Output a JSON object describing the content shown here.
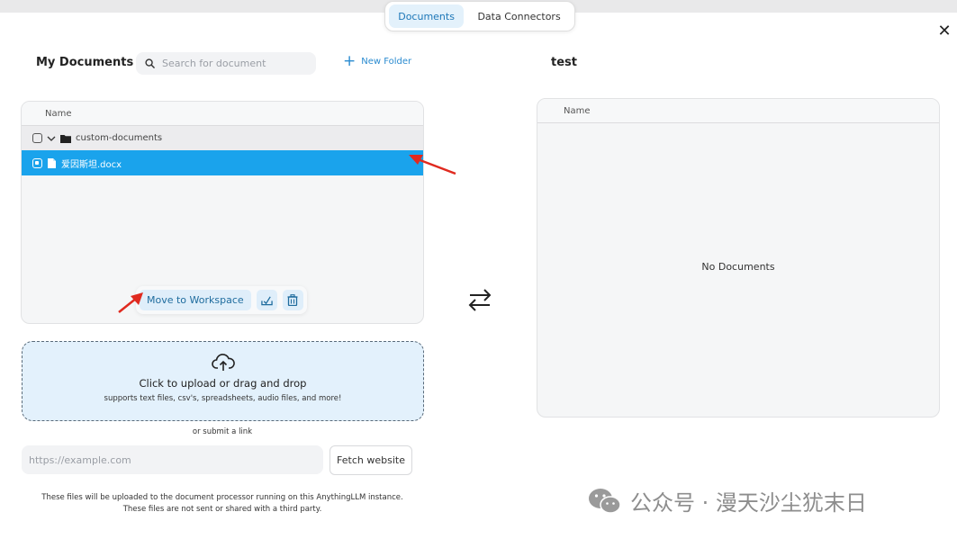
{
  "tabs": [
    {
      "label": "Documents",
      "active": true
    },
    {
      "label": "Data Connectors",
      "active": false
    }
  ],
  "left": {
    "title": "My Documents",
    "search_placeholder": "Search for document",
    "new_folder_label": "New Folder",
    "column_name": "Name",
    "folder_name": "custom-documents",
    "file_name": "爱因斯坦.docx",
    "move_button_label": "Move to Workspace"
  },
  "right": {
    "title": "test",
    "column_name": "Name",
    "empty_text": "No Documents"
  },
  "upload": {
    "title": "Click to upload or drag and drop",
    "subtitle": "supports text files, csv's, spreadsheets, audio files, and more!",
    "or_link": "or submit a link",
    "url_placeholder": "https://example.com",
    "fetch_label": "Fetch website",
    "notice_line1": "These files will be uploaded to the document processor running on this AnythingLLM instance.",
    "notice_line2": "These files are not sent or shared with a third party."
  },
  "watermark": {
    "text": "公众号 · 漫天沙尘犹末日"
  },
  "colors": {
    "accent": "#1aa3ec",
    "tab_active_bg": "#e3f1fb",
    "upload_bg": "#e3f1fc",
    "annotation_arrow": "#e02a1f"
  },
  "icons": {
    "close": "close-icon",
    "search": "search-icon",
    "plus": "plus-icon",
    "chevron": "chevron-down-icon",
    "folder": "folder-icon",
    "file": "file-icon",
    "move_down": "tray-download-icon",
    "trash": "trash-icon",
    "swap": "swap-arrows-icon",
    "upload": "cloud-upload-icon"
  }
}
